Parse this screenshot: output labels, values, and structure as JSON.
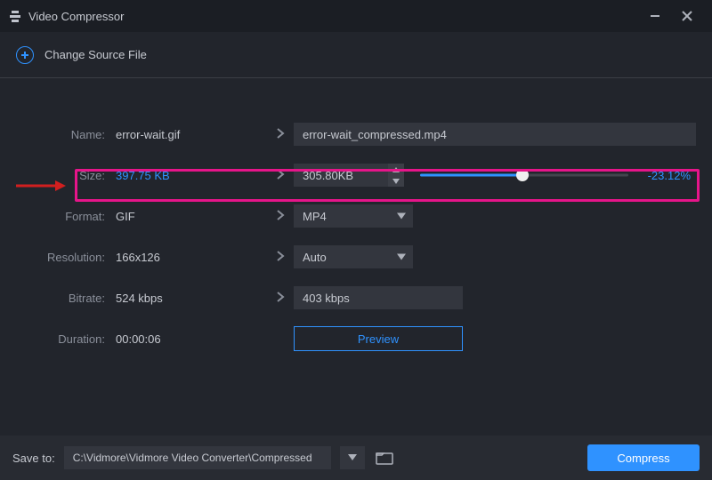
{
  "titlebar": {
    "title": "Video Compressor"
  },
  "source": {
    "change_label": "Change Source File"
  },
  "form": {
    "name": {
      "label": "Name:",
      "source": "error-wait.gif",
      "target": "error-wait_compressed.mp4"
    },
    "size": {
      "label": "Size:",
      "source": "397.75 KB",
      "target": "305.80KB",
      "percent": "-23.12%",
      "slider_pct": 49
    },
    "format": {
      "label": "Format:",
      "source": "GIF",
      "target": "MP4"
    },
    "resolution": {
      "label": "Resolution:",
      "source": "166x126",
      "target": "Auto"
    },
    "bitrate": {
      "label": "Bitrate:",
      "source": "524 kbps",
      "target": "403 kbps"
    },
    "duration": {
      "label": "Duration:",
      "source": "00:00:06",
      "preview_label": "Preview"
    }
  },
  "footer": {
    "save_label": "Save to:",
    "path": "C:\\Vidmore\\Vidmore Video Converter\\Compressed",
    "compress_label": "Compress"
  }
}
